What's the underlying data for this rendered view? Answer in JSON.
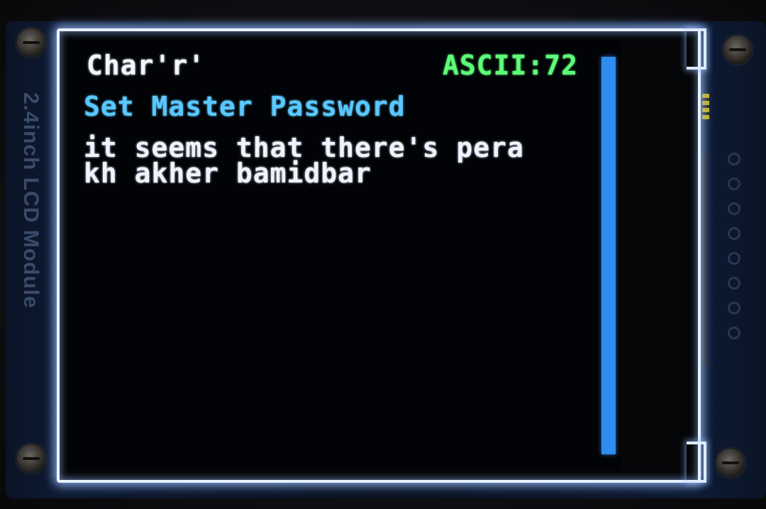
{
  "device": {
    "silkscreen": "2.4inch LCD Module"
  },
  "screen": {
    "char_label": "Char'r'",
    "ascii_label": "ASCII:72",
    "title": "Set Master Password",
    "message_lines": [
      "it seems that there's pera",
      "kh akher bamidbar"
    ]
  },
  "colors": {
    "char_label": "#f2f6ff",
    "ascii_label": "#5fff7a",
    "title": "#5ac8ff",
    "message": "#eef4ff",
    "scrollbar": "#2f8cf0"
  }
}
